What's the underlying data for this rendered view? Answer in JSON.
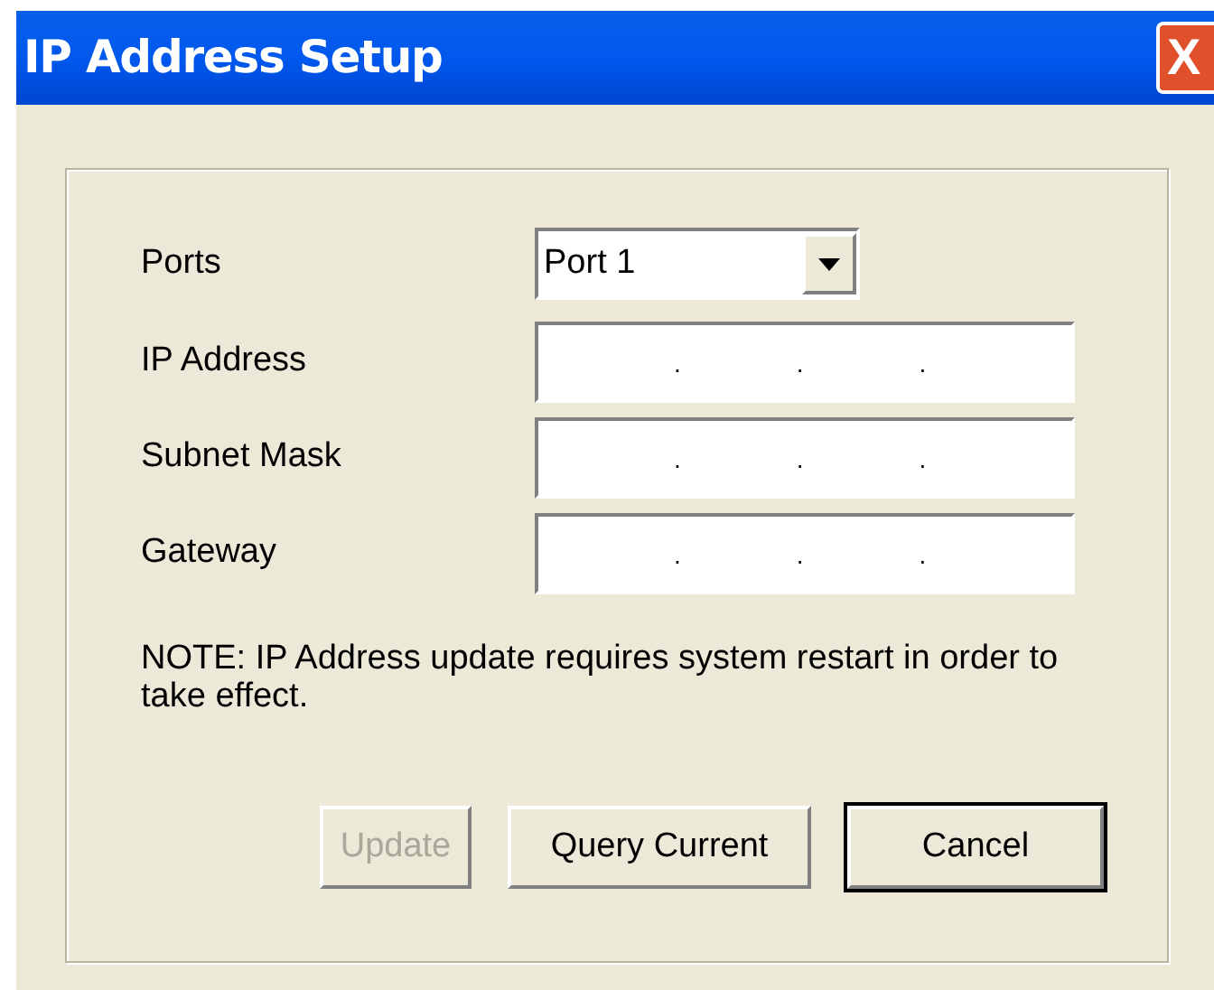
{
  "window": {
    "title": "IP Address Setup",
    "close_button": "X"
  },
  "ports": {
    "label": "Ports",
    "value": "Port 1"
  },
  "fields": [
    {
      "label": "IP Address",
      "separators": [
        ".",
        ".",
        "."
      ]
    },
    {
      "label": "Subnet Mask",
      "separators": [
        ".",
        ".",
        "."
      ]
    },
    {
      "label": "Gateway",
      "separators": [
        ".",
        ".",
        "."
      ]
    }
  ],
  "note": "NOTE: IP Address update requires system restart in order to take effect.",
  "buttons": [
    {
      "label": "Update",
      "disabled": true,
      "default": false
    },
    {
      "label": "Query Current",
      "disabled": false,
      "default": false
    },
    {
      "label": "Cancel",
      "disabled": false,
      "default": true
    }
  ]
}
